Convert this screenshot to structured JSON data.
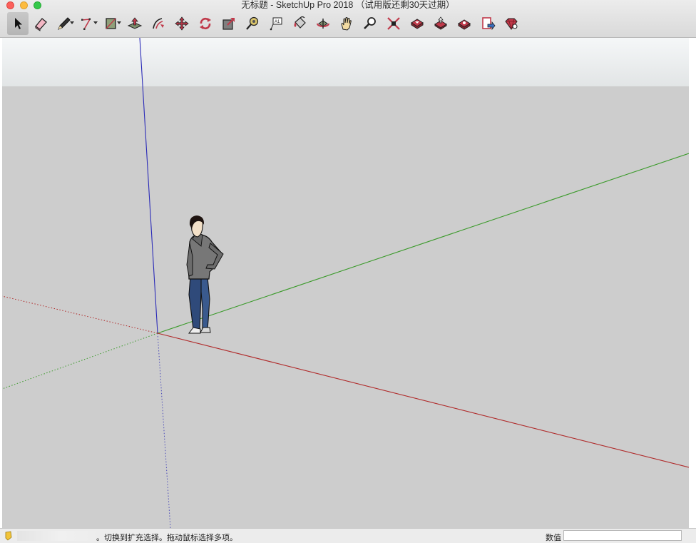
{
  "window": {
    "title": "无标题 - SketchUp Pro 2018 （试用版还剩30天过期）"
  },
  "toolbar": {
    "tools": [
      {
        "name": "select-tool",
        "icon": "arrow-cursor-icon"
      },
      {
        "name": "eraser-tool",
        "icon": "eraser-icon"
      },
      {
        "name": "line-tool",
        "icon": "pencil-icon",
        "dropdown": true
      },
      {
        "name": "arc-tool",
        "icon": "arc-icon",
        "dropdown": true
      },
      {
        "name": "rectangle-tool",
        "icon": "rectangle-icon",
        "dropdown": true
      },
      {
        "name": "push-pull-tool",
        "icon": "push-pull-icon"
      },
      {
        "name": "offset-tool",
        "icon": "offset-icon"
      },
      {
        "name": "move-tool",
        "icon": "move-icon"
      },
      {
        "name": "rotate-tool",
        "icon": "rotate-icon"
      },
      {
        "name": "scale-tool",
        "icon": "scale-icon"
      },
      {
        "name": "tape-measure-tool",
        "icon": "tape-measure-icon"
      },
      {
        "name": "text-tool",
        "icon": "text-icon"
      },
      {
        "name": "paint-bucket-tool",
        "icon": "paint-bucket-icon"
      },
      {
        "name": "orbit-tool",
        "icon": "orbit-icon"
      },
      {
        "name": "pan-tool",
        "icon": "hand-icon"
      },
      {
        "name": "zoom-tool",
        "icon": "magnifier-icon"
      },
      {
        "name": "zoom-extents-tool",
        "icon": "zoom-extents-icon"
      },
      {
        "name": "3d-warehouse-tool",
        "icon": "warehouse-icon"
      },
      {
        "name": "share-model-tool",
        "icon": "share-model-icon"
      },
      {
        "name": "extension-warehouse-tool",
        "icon": "extension-warehouse-icon"
      },
      {
        "name": "layout-send-tool",
        "icon": "layout-icon"
      },
      {
        "name": "extension-manager-tool",
        "icon": "ruby-gem-icon"
      }
    ]
  },
  "colors": {
    "sky": "#eef0f1",
    "ground": "#cdcdcd",
    "red_axis": "#b02a2a",
    "green_axis": "#3a9a2a",
    "blue_axis": "#2b2bb8"
  },
  "status": {
    "hint": "。切换到扩充选择。拖动鼠标选择多项。",
    "measurements_label": "数值",
    "measurements_value": ""
  }
}
